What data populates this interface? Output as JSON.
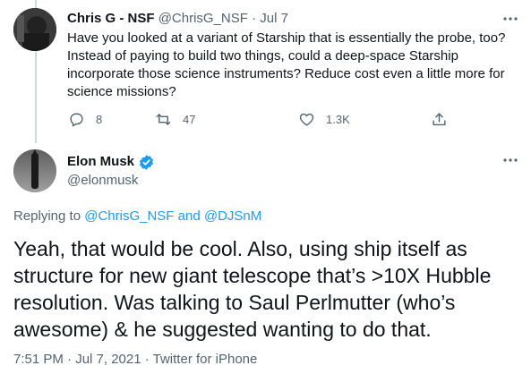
{
  "tweet1": {
    "name": "Chris G - NSF",
    "handle": "@ChrisG_NSF",
    "separator": "·",
    "date": "Jul 7",
    "body": "Have you looked at a variant of Starship that is essentially the probe, too? Instead of paying to build two things, could a deep-space Starship incorporate those science instruments? Reduce cost even a little more for science missions?",
    "more_icon": "more-horizontal-icon",
    "actions": {
      "reply_icon": "reply-icon",
      "reply_count": "8",
      "retweet_icon": "retweet-icon",
      "retweet_count": "47",
      "like_icon": "heart-icon",
      "like_count": "1.3K",
      "share_icon": "share-icon"
    }
  },
  "tweet2": {
    "name": "Elon Musk",
    "handle": "@elonmusk",
    "verified_icon": "verified-badge-icon",
    "more_icon": "more-horizontal-icon",
    "replying_prefix": "Replying to",
    "mention1": "@ChrisG_NSF",
    "and_word": "and",
    "mention2": "@DJSnM",
    "text": "Yeah, that would be cool. Also, using ship itself as structure for new giant telescope that’s >10X Hubble resolution. Was talking to Saul Perlmutter (who’s awesome) & he suggested wanting to do that.",
    "meta": "7:51 PM · Jul 7, 2021 · Twitter for iPhone"
  },
  "colors": {
    "text": "#0f1419",
    "secondary": "#536471",
    "accent": "#1d9bf0",
    "thread_line": "#cfd9de"
  }
}
